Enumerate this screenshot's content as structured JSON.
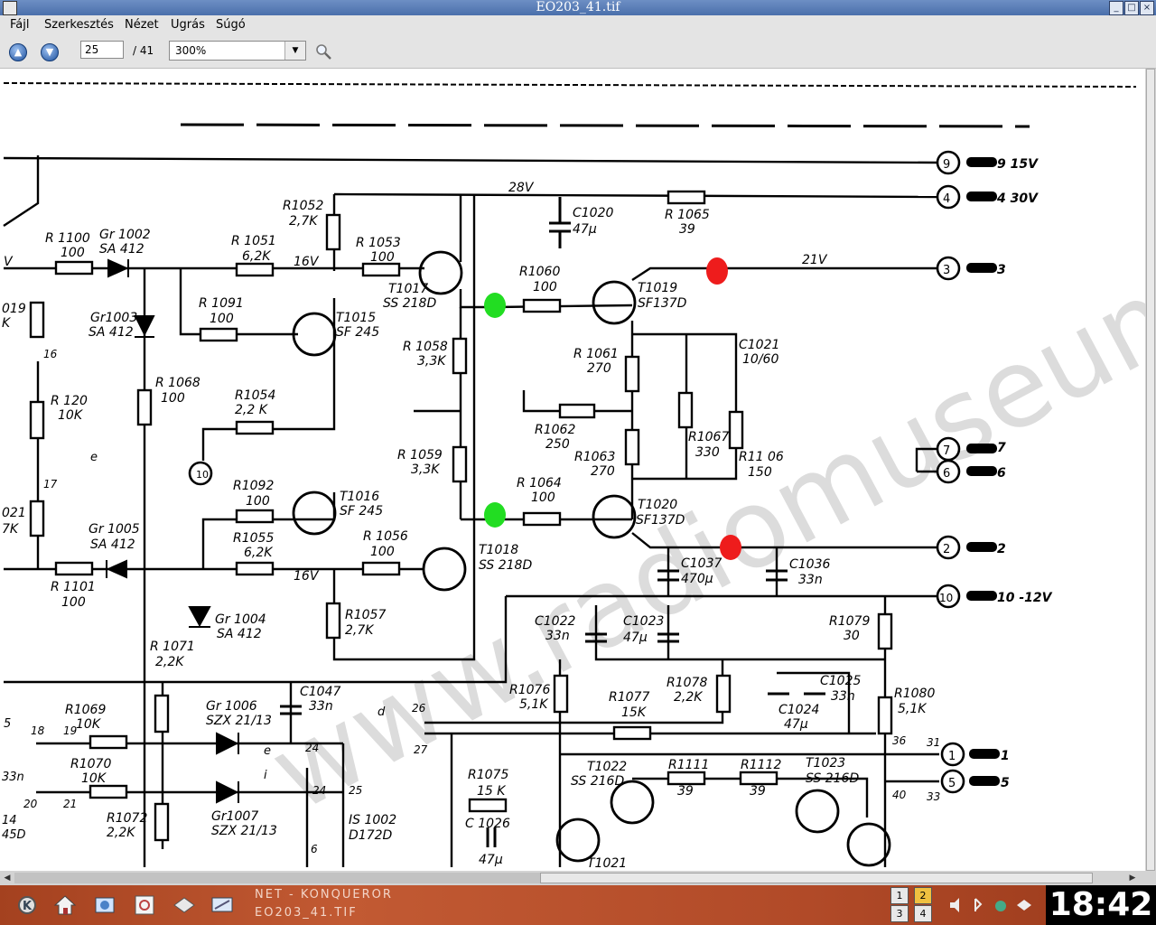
{
  "window": {
    "title": "EO203_41.tif"
  },
  "menu": {
    "file": "Fájl",
    "edit": "Szerkesztés",
    "view": "Nézet",
    "go": "Ugrás",
    "help": "Súgó"
  },
  "toolbar": {
    "page_value": "25",
    "page_total": "/ 41",
    "zoom": "300%"
  },
  "schematic": {
    "labels": {
      "v28": "28V",
      "v16a": "16V",
      "v16b": "16V",
      "v21": "21V",
      "r1100": "R 1100",
      "r1100v": "100",
      "gr1002": "Gr 1002",
      "gr1002v": "SA 412",
      "r1052": "R1052",
      "r1052v": "2,7K",
      "r1051": "R 1051",
      "r1051v": "6,2K",
      "r1053": "R 1053",
      "r1053v": "100",
      "t1017": "T1017",
      "t1017v": "SS 218D",
      "c1020": "C1020",
      "c1020v": "47µ",
      "r1065": "R 1065",
      "r1065v": "39",
      "r1060": "R1060",
      "r1060v": "100",
      "t1019": "T1019",
      "t1019v": "SF137D",
      "gr1003": "Gr1003",
      "gr1003v": "SA 412",
      "r1091": "R 1091",
      "r1091v": "100",
      "t1015": "T1015",
      "t1015v": "SF 245",
      "r1058": "R 1058",
      "r1058v": "3,3K",
      "r1061": "R 1061",
      "r1061v": "270",
      "c1021": "C1021",
      "c1021v": "10/60",
      "r1068": "R 1068",
      "r1068v": "100",
      "r120": "R 120",
      "r120v": "10K",
      "r1054": "R1054",
      "r1054v": "2,2 K",
      "r1062": "R1062",
      "r1062v": "250",
      "r1067": "R1067",
      "r1067v": "330",
      "r1106": "R11 06",
      "r1106v": "150",
      "r1059": "R 1059",
      "r1059v": "3,3K",
      "r1063": "R1063",
      "r1063v": "270",
      "r1092": "R1092",
      "r1092v": "100",
      "t1016": "T1016",
      "t1016v": "SF 245",
      "r1064": "R 1064",
      "r1064v": "100",
      "t1020": "T1020",
      "t1020v": "SF137D",
      "gr1005": "Gr 1005",
      "gr1005v": "SA 412",
      "r1055": "R1055",
      "r1055v": "6,2K",
      "r1056": "R 1056",
      "r1056v": "100",
      "t1018": "T1018",
      "t1018v": "SS 218D",
      "c1037": "C1037",
      "c1037v": "470µ",
      "c1036": "C1036",
      "c1036v": "33n",
      "r1101": "R 1101",
      "r1101v": "100",
      "gr1004": "Gr 1004",
      "gr1004v": "SA 412",
      "r1057": "R1057",
      "r1057v": "2,7K",
      "c1022": "C1022",
      "c1022v": "33n",
      "c1023": "C1023",
      "c1023v": "47µ",
      "r1079": "R1079",
      "r1079v": "30",
      "r1071": "R 1071",
      "r1071v": "2,2K",
      "gr1006": "Gr 1006",
      "gr1006v": "SZX 21/13",
      "c1047": "C1047",
      "c1047v": "33n",
      "r1076": "R1076",
      "r1076v": "5,1K",
      "r1077": "R1077",
      "r1077v": "15K",
      "r1078": "R1078",
      "r1078v": "2,2K",
      "c1025": "C1025",
      "c1025v": "33n",
      "c1024": "C1024",
      "c1024v": "47µ",
      "r1080": "R1080",
      "r1080v": "5,1K",
      "r1069": "R1069",
      "r1069v": "10K",
      "r1070": "R1070",
      "r1070v": "10K",
      "r1072": "R1072",
      "r1072v": "2,2K",
      "gr1007": "Gr1007",
      "gr1007v": "SZX 21/13",
      "is1002": "IS 1002",
      "is1002v": "D172D",
      "r1075": "R1075",
      "r1075v": "15 K",
      "c1026": "C 1026",
      "c1026v": "47µ",
      "t1022": "T1022",
      "t1022v": "SS 216D",
      "r1111": "R1111",
      "r1111v": "39",
      "r1112": "R1112",
      "r1112v": "39",
      "t1023": "T1023",
      "t1023v": "SS 216D",
      "t1021": "T1021",
      "out_9": "9",
      "out_9v": "9  15V",
      "out_4": "4",
      "out_4v": "4   30V",
      "out_3": "3",
      "out_3v": "3",
      "out_7": "7",
      "out_7v": "7",
      "out_6": "6",
      "out_6v": "6",
      "out_2": "2",
      "out_2v": "2",
      "out_10": "10",
      "out_10v": "10  -12V",
      "out_1": "1",
      "out_1v": "1",
      "out_5": "5",
      "out_5v": "5",
      "n10": "10",
      "n16": "16",
      "n17": "17",
      "n18": "18",
      "n19": "19",
      "n20": "20",
      "n21": "21",
      "n24a": "24",
      "n24b": "24",
      "n25": "25",
      "n26": "26",
      "n27": "27",
      "n36": "36",
      "n31": "31",
      "n40": "40",
      "n33": "33",
      "n6": "6",
      "d": "d",
      "e": "e",
      "e2": "e",
      "i": "i",
      "left1": "V",
      "left2": "019",
      "left3": "K",
      "left4": "021",
      "left5": "7K",
      "left6": "5",
      "left7": "33n",
      "left8": "14",
      "left9": "45D"
    }
  },
  "taskbar": {
    "task1": "NET - KONQUEROR",
    "task2": "EO203_41.TIF",
    "clock": "18:42",
    "pager1": "1",
    "pager2": "2",
    "pager3": "3",
    "pager4": "4"
  },
  "colors": {
    "marker_green": "#22dd22",
    "marker_red": "#ee1c1c",
    "watermark": "#d8d8d8"
  },
  "watermark": {
    "text": "www.radiomuseum.de"
  }
}
